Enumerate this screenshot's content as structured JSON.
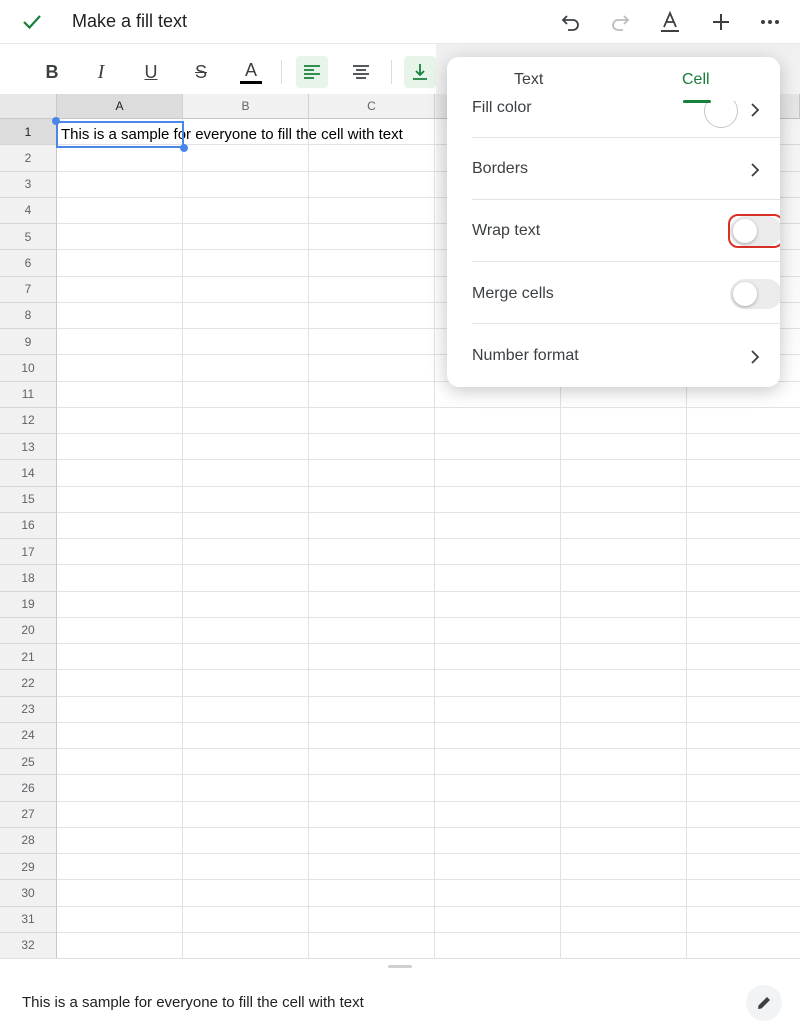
{
  "app": {
    "title": "Make a fill text",
    "icons": [
      "check-icon",
      "undo-icon",
      "redo-icon",
      "text-format-icon",
      "add-icon",
      "more-icon"
    ]
  },
  "toolbar": {
    "buttons": [
      {
        "name": "bold",
        "glyph": "B"
      },
      {
        "name": "italic",
        "glyph": "I"
      },
      {
        "name": "underline",
        "glyph": "U"
      },
      {
        "name": "strikethrough",
        "glyph": "S"
      },
      {
        "name": "text-color",
        "glyph": "A"
      },
      {
        "name": "align-left",
        "active": true
      },
      {
        "name": "align-center"
      },
      {
        "name": "vertical-align-bottom",
        "active": true
      }
    ]
  },
  "sheet": {
    "columns": [
      "A",
      "B",
      "C"
    ],
    "rows": [
      "1",
      "2",
      "3",
      "4",
      "5",
      "6",
      "7",
      "8",
      "9",
      "10",
      "11",
      "12",
      "13",
      "14",
      "15",
      "16",
      "17",
      "18",
      "19",
      "20",
      "21",
      "22",
      "23",
      "24",
      "25",
      "26",
      "27",
      "28",
      "29",
      "30",
      "31",
      "32"
    ],
    "selected_cell": "A1",
    "cell_a1": "This is a sample for everyone to fill the cell with text"
  },
  "formula_bar": {
    "value": "This is a sample for everyone to fill the cell with text"
  },
  "panel": {
    "tabs": [
      {
        "label": "Text",
        "active": false
      },
      {
        "label": "Cell",
        "active": true
      }
    ],
    "rows": {
      "fill_color": "Fill color",
      "borders": "Borders",
      "wrap_text": "Wrap text",
      "merge_cells": "Merge cells",
      "number_format": "Number format"
    },
    "wrap_text_on": false,
    "merge_cells_on": false
  },
  "colors": {
    "accent_green": "#188038",
    "selection_blue": "#4a86e8",
    "highlight_red": "#d93025"
  }
}
